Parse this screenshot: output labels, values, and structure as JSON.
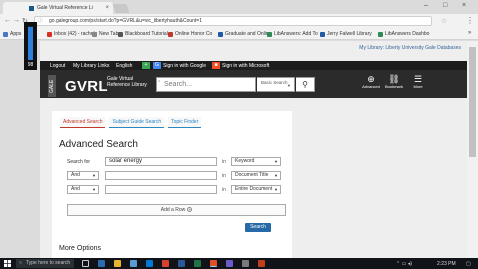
{
  "browser": {
    "tab_title": "Gale Virtual Reference Li",
    "url": "go.galegroup.com/ps/start.do?p=GVRL&u=vic_libertyhauth&Count=1",
    "bookmarks": [
      {
        "label": "Apps",
        "color": "#4a78c8"
      },
      {
        "label": "Inbox (42) - rachelc",
        "color": "#d93025"
      },
      {
        "label": "New Tab",
        "color": "#888888"
      },
      {
        "label": "Blackboard Tutorial",
        "color": "#555555"
      },
      {
        "label": "Online Honor Co",
        "color": "#c0392b"
      },
      {
        "label": "Graduate and Onlin",
        "color": "#1e5aa6"
      },
      {
        "label": "LibAnswers: Add To",
        "color": "#2e8b57"
      },
      {
        "label": "Jerry Falwell Library",
        "color": "#1e5aa6"
      },
      {
        "label": "LibAnswers Dashbo",
        "color": "#2e8b57"
      }
    ],
    "more": "»"
  },
  "gale": {
    "user_links": "My Library: Liberty University   Gale Databases",
    "topbar": {
      "logout": "Logout",
      "my_library_links": "My Library Links",
      "english": "English",
      "google_signin": "Sign in with Google",
      "microsoft_signin": "Sign in with Microsoft"
    },
    "logo_tab": "GALE",
    "logo": "GVRL",
    "logo_sub": "Gale Virtual Reference Library",
    "search_placeholder": "Search...",
    "basic_search": "Basic Search",
    "icons": {
      "advanced": "Advanced",
      "bookmark": "Bookmark",
      "more": "More"
    }
  },
  "panel": {
    "tabs": [
      {
        "label": "Advanced Search",
        "color": "#c0392b"
      },
      {
        "label": "Subject Guide Search",
        "color": "#2e86c1"
      },
      {
        "label": "Topic Finder",
        "color": "#2e86c1"
      }
    ],
    "heading": "Advanced Search",
    "rows": [
      {
        "first": "Search for",
        "value": "solar energy",
        "in": "in",
        "field": "Keyword"
      },
      {
        "first": "And",
        "value": "",
        "in": "in",
        "field": "Document Title"
      },
      {
        "first": "And",
        "value": "",
        "in": "in",
        "field": "Entire Document"
      }
    ],
    "add_row": "Add a Row",
    "search_button": "Search",
    "more_options": "More Options"
  },
  "recorder": {
    "value": "98",
    "level": 0.98,
    "color": "#2f7fde"
  },
  "taskbar": {
    "search_placeholder": "Type here to search",
    "time": "2:23 PM"
  }
}
